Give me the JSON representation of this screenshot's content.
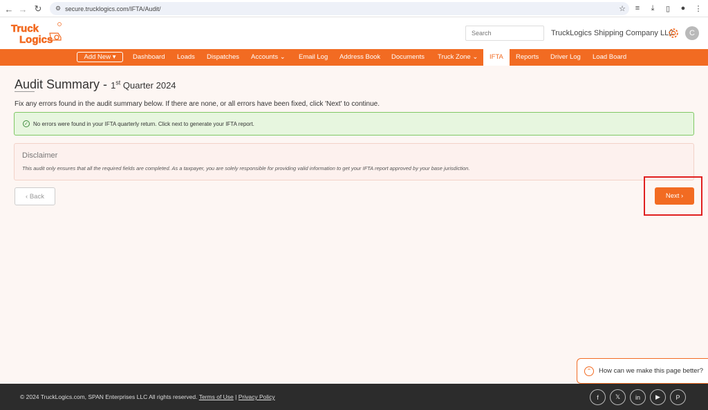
{
  "browser": {
    "url": "secure.trucklogics.com/IFTA/Audit/"
  },
  "header": {
    "logo_text_line1": "Truck",
    "logo_text_line2": "Logics",
    "search_placeholder": "Search",
    "company_name": "TruckLogics Shipping Company LLC",
    "avatar_initial": "C",
    "brand_color": "#f26b22"
  },
  "nav": {
    "add_new": "Add New ▾",
    "items": [
      "Dashboard",
      "Loads",
      "Dispatches",
      "Accounts ⌄",
      "Email Log",
      "Address Book",
      "Documents",
      "Truck Zone ⌄",
      "IFTA",
      "Reports",
      "Driver Log",
      "Load Board"
    ],
    "active": "IFTA"
  },
  "main": {
    "title": "Audit Summary -",
    "quarter_num": "1",
    "quarter_suffix": "st",
    "quarter_rest": " Quarter 2024",
    "instruction": "Fix any errors found in the audit summary below. If there are none, or all errors have been fixed, click 'Next' to continue.",
    "success_message": "No errors were found in your IFTA quarterly return. Click next to generate your IFTA report.",
    "disclaimer_title": "Disclaimer",
    "disclaimer_text": "This audit only ensures that all the required fields are completed. As a taxpayer, you are solely responsible for providing valid information to get your IFTA report approved by your base jurisdiction.",
    "back_label": "‹ Back",
    "next_label": "Next ›"
  },
  "feedback": {
    "label": "How can we make this page better?"
  },
  "footer": {
    "copyright": "© 2024 TruckLogics.com, SPAN Enterprises LLC All rights reserved.",
    "terms": "Terms of Use",
    "separator": "|",
    "privacy": "Privacy Policy",
    "socials": [
      "facebook-icon",
      "x-icon",
      "linkedin-icon",
      "youtube-icon",
      "pinterest-icon"
    ]
  }
}
